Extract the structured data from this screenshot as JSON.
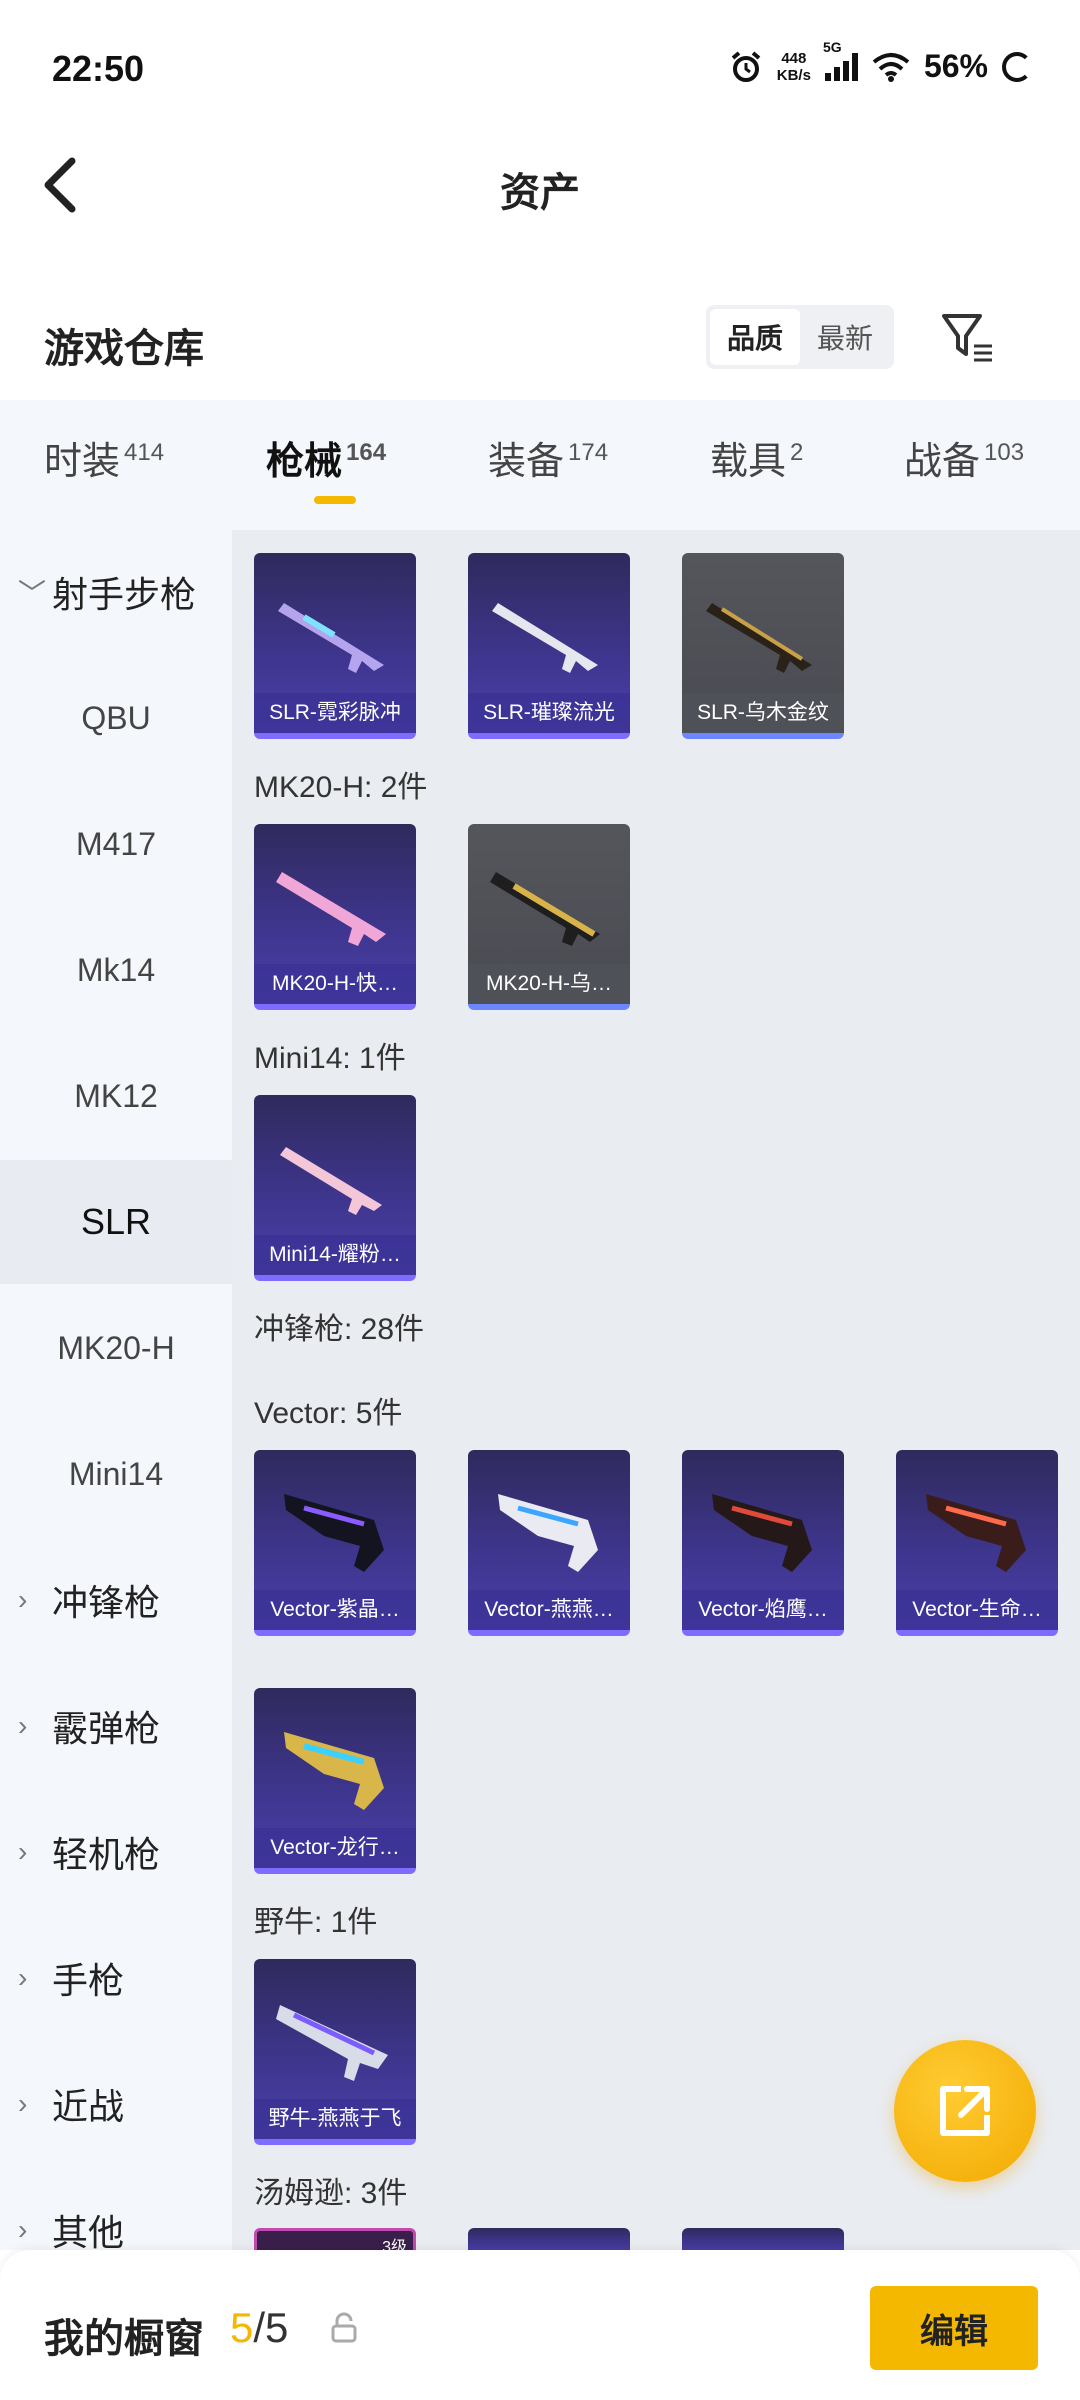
{
  "status": {
    "time": "22:50",
    "net_speed_value": "448",
    "net_speed_unit": "KB/s",
    "network": "5G",
    "battery": "56%"
  },
  "header": {
    "title": "资产"
  },
  "warehouse": {
    "title": "游戏仓库",
    "sort_options": [
      "品质",
      "最新"
    ],
    "active_sort": "品质"
  },
  "tabs": [
    {
      "label": "时装",
      "count": "414"
    },
    {
      "label": "枪械",
      "count": "164",
      "active": true
    },
    {
      "label": "装备",
      "count": "174"
    },
    {
      "label": "载具",
      "count": "2"
    },
    {
      "label": "战备",
      "count": "103"
    }
  ],
  "sidebar": {
    "items": [
      {
        "label": "射手步枪",
        "type": "group",
        "expanded": true
      },
      {
        "label": "QBU",
        "type": "sub"
      },
      {
        "label": "M417",
        "type": "sub"
      },
      {
        "label": "Mk14",
        "type": "sub"
      },
      {
        "label": "MK12",
        "type": "sub"
      },
      {
        "label": "SLR",
        "type": "sub",
        "selected": true
      },
      {
        "label": "MK20-H",
        "type": "sub"
      },
      {
        "label": "Mini14",
        "type": "sub"
      },
      {
        "label": "冲锋枪",
        "type": "group"
      },
      {
        "label": "霰弹枪",
        "type": "group"
      },
      {
        "label": "轻机枪",
        "type": "group"
      },
      {
        "label": "手枪",
        "type": "group"
      },
      {
        "label": "近战",
        "type": "group"
      },
      {
        "label": "其他",
        "type": "group"
      }
    ]
  },
  "content": {
    "groups": {
      "mk20h": "MK20-H: 2件",
      "mini14": "Mini14: 1件",
      "smg": "冲锋枪: 28件",
      "vector": "Vector: 5件",
      "yeniu": "野牛: 1件",
      "tommy": "汤姆逊: 3件"
    },
    "items": {
      "slr1": "SLR-霓彩脉冲",
      "slr2": "SLR-璀璨流光",
      "slr3": "SLR-乌木金纹",
      "mk20h1": "MK20-H-快…",
      "mk20h2": "MK20-H-乌…",
      "mini14_1": "Mini14-耀粉…",
      "vec1": "Vector-紫晶…",
      "vec2": "Vector-燕燕…",
      "vec3": "Vector-焰鹰…",
      "vec4": "Vector-生命…",
      "vec5": "Vector-龙行…",
      "yeniu1": "野牛-燕燕于飞",
      "tommy_level": "3级"
    }
  },
  "bottom": {
    "showcase_label": "我的橱窗",
    "showcase_current": "5",
    "showcase_total": "/5",
    "edit_label": "编辑"
  },
  "colors": {
    "accent": "#f5b800",
    "card_purple": "#3f3690",
    "card_gray": "#4f5056",
    "sidebar_bg": "#f4f7fb",
    "content_bg": "#e9ecf1"
  }
}
